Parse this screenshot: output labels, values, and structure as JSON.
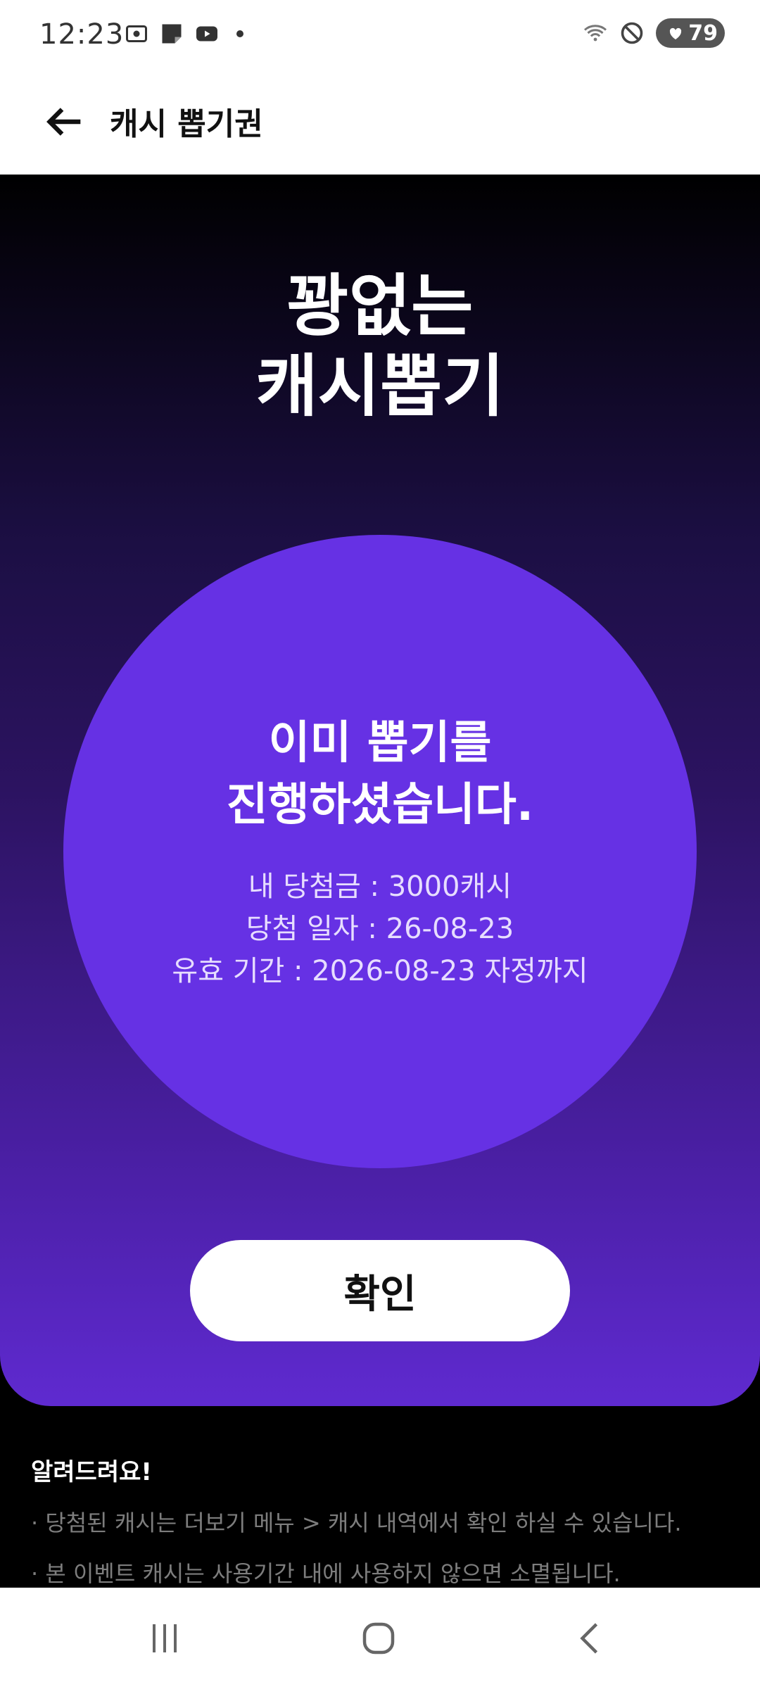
{
  "status": {
    "time": "12:23",
    "battery": "79"
  },
  "app_bar": {
    "title": "캐시 뽑기권"
  },
  "hero": {
    "title_line1": "꽝없는",
    "title_line2": "캐시뽑기",
    "message_line1": "이미 뽑기를",
    "message_line2": "진행하셨습니다.",
    "info": [
      "내 당첨금 : 3000캐시",
      "당첨 일자 : 26-08-23",
      "유효 기간 : 2026-08-23 자정까지"
    ],
    "confirm_label": "확인"
  },
  "notice": {
    "title": "알려드려요!",
    "items": [
      "· 당첨된 캐시는 더보기 메뉴 > 캐시 내역에서 확인 하실 수 있습니다.",
      "· 본 이벤트 캐시는 사용기간 내에 사용하지 않으면 소멸됩니다."
    ]
  },
  "colors": {
    "accent_purple": "#6631e4",
    "hero_bottom": "#5f2ad0"
  }
}
